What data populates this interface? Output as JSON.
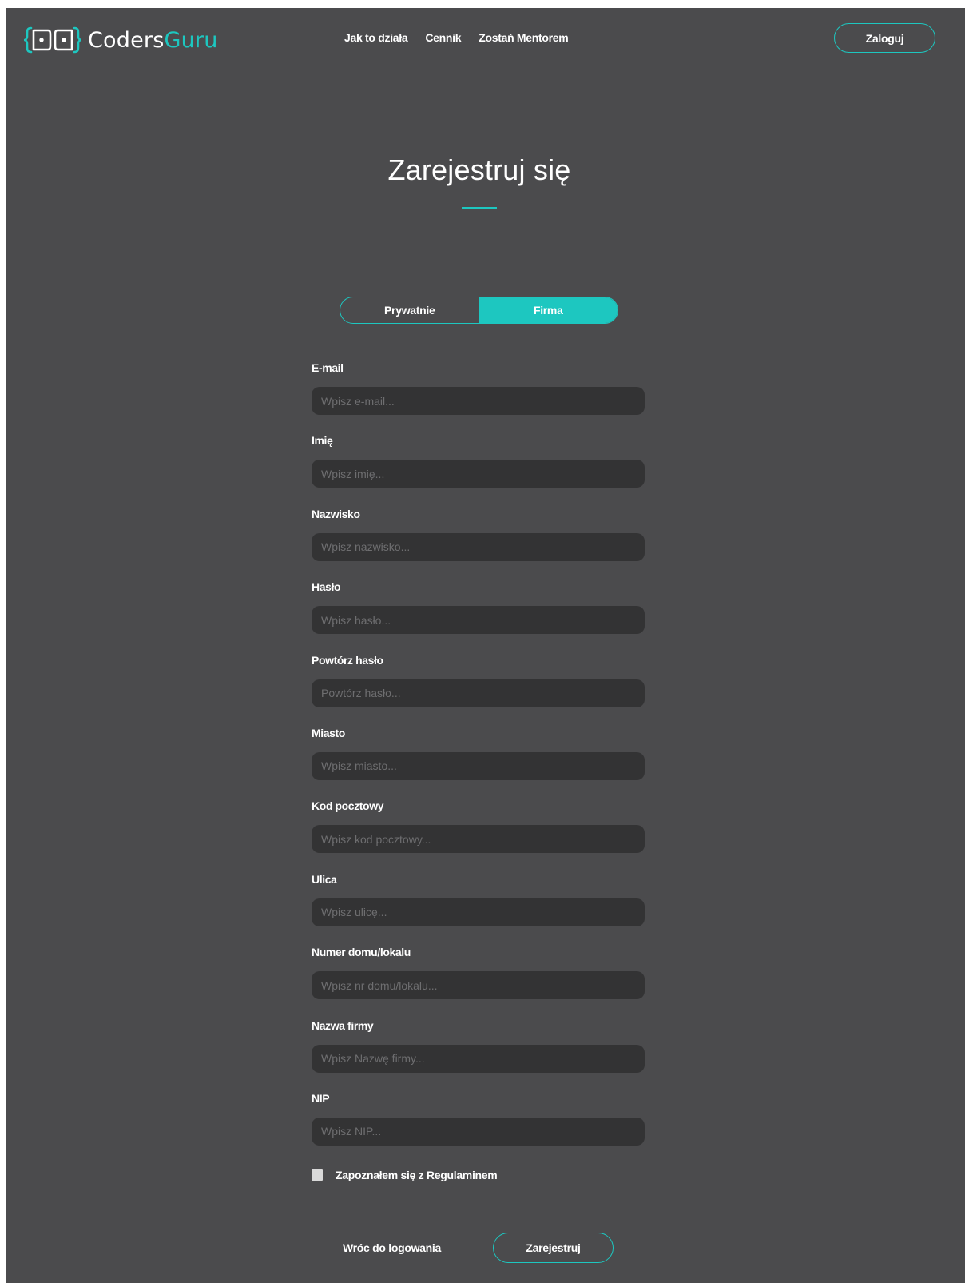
{
  "brand": {
    "name_part1": "Coders",
    "name_part2": "Guru",
    "accent_color": "#1dc7c0",
    "logo_icon": "brackets-eyes-logo-icon"
  },
  "nav": {
    "items": [
      "Jak to działa",
      "Cennik",
      "Zostań Mentorem"
    ],
    "login_label": "Zaloguj"
  },
  "page": {
    "title": "Zarejestruj się",
    "background_color": "#4b4b4d",
    "input_background": "#333334"
  },
  "account_type": {
    "options": [
      "Prywatnie",
      "Firma"
    ],
    "selected": "Firma"
  },
  "form": {
    "fields": [
      {
        "label": "E-mail",
        "placeholder": "Wpisz e-mail..."
      },
      {
        "label": "Imię",
        "placeholder": "Wpisz imię..."
      },
      {
        "label": "Nazwisko",
        "placeholder": "Wpisz nazwisko..."
      },
      {
        "label": "Hasło",
        "placeholder": "Wpisz hasło..."
      },
      {
        "label": "Powtórz hasło",
        "placeholder": "Powtórz hasło..."
      },
      {
        "label": "Miasto",
        "placeholder": "Wpisz miasto..."
      },
      {
        "label": "Kod pocztowy",
        "placeholder": "Wpisz kod pocztowy..."
      },
      {
        "label": "Ulica",
        "placeholder": "Wpisz ulicę..."
      },
      {
        "label": "Numer domu/lokalu",
        "placeholder": "Wpisz nr domu/lokalu..."
      },
      {
        "label": "Nazwa firmy",
        "placeholder": "Wpisz Nazwę firmy..."
      },
      {
        "label": "NIP",
        "placeholder": "Wpisz NIP..."
      }
    ],
    "terms_label": "Zapoznałem się z Regulaminem",
    "terms_checked": false,
    "back_label": "Wróc do logowania",
    "submit_label": "Zarejestruj"
  }
}
